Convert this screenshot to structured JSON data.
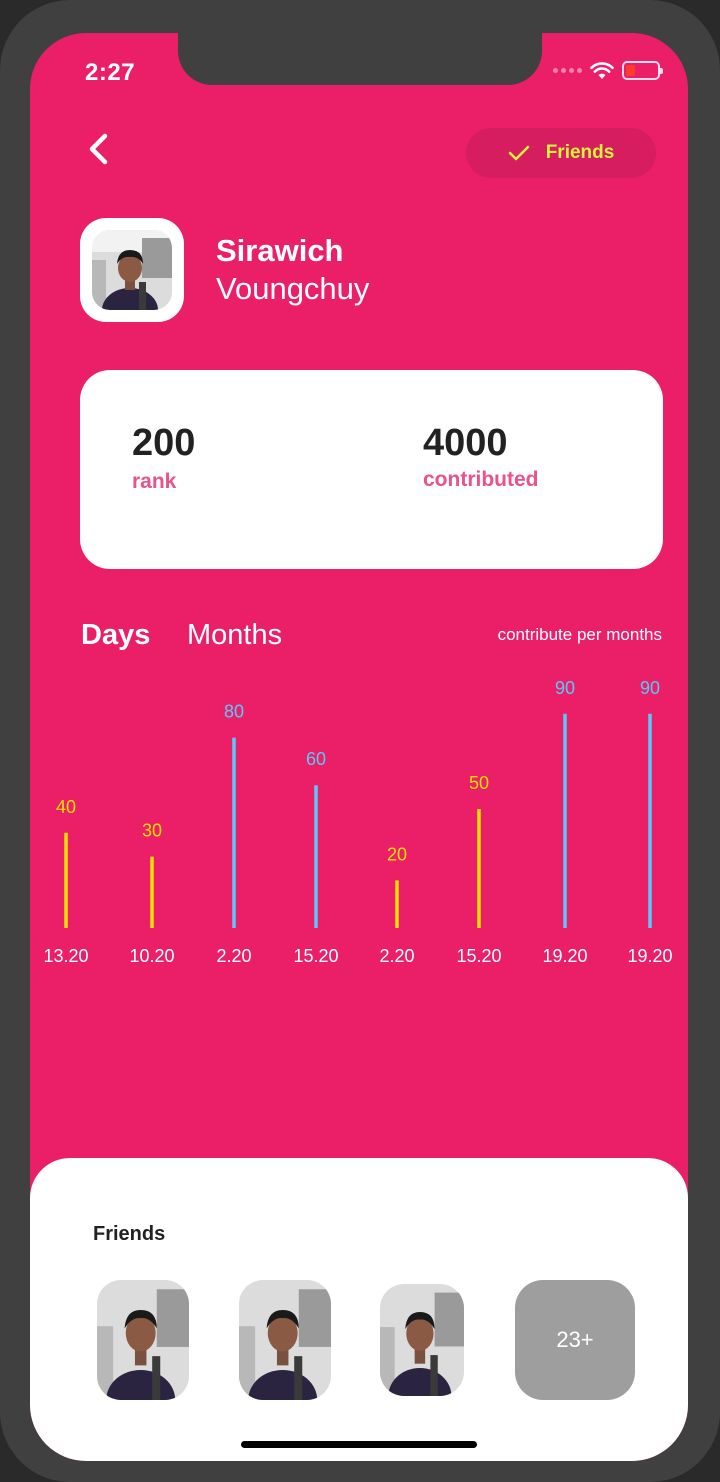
{
  "status": {
    "time": "2:27"
  },
  "header": {
    "friends_chip": "Friends"
  },
  "profile": {
    "first_name": "Sirawich",
    "last_name": "Voungchuy"
  },
  "stats": [
    {
      "value": "200",
      "label": "rank"
    },
    {
      "value": "4000",
      "label": "contributed"
    }
  ],
  "tabs": {
    "days": "Days",
    "months": "Months"
  },
  "chart_caption": "contribute per months",
  "chart_data": {
    "type": "bar",
    "categories": [
      "13.20",
      "10.20",
      "2.20",
      "15.20",
      "2.20",
      "15.20",
      "19.20",
      "19.20"
    ],
    "values": [
      40,
      30,
      80,
      60,
      20,
      50,
      90,
      90
    ],
    "title": "",
    "xlabel": "",
    "ylabel": "",
    "colors": [
      "#ffe000",
      "#ffe000",
      "#5ac8fa",
      "#5ac8fa",
      "#ffe000",
      "#ffe000",
      "#5ac8fa",
      "#5ac8fa"
    ],
    "grid": false
  },
  "friends": {
    "title": "Friends",
    "more_count": "23+"
  },
  "colors": {
    "accent": "#ea1f68",
    "chip_text": "#d6f33a",
    "stat_label": "#e9528a"
  }
}
